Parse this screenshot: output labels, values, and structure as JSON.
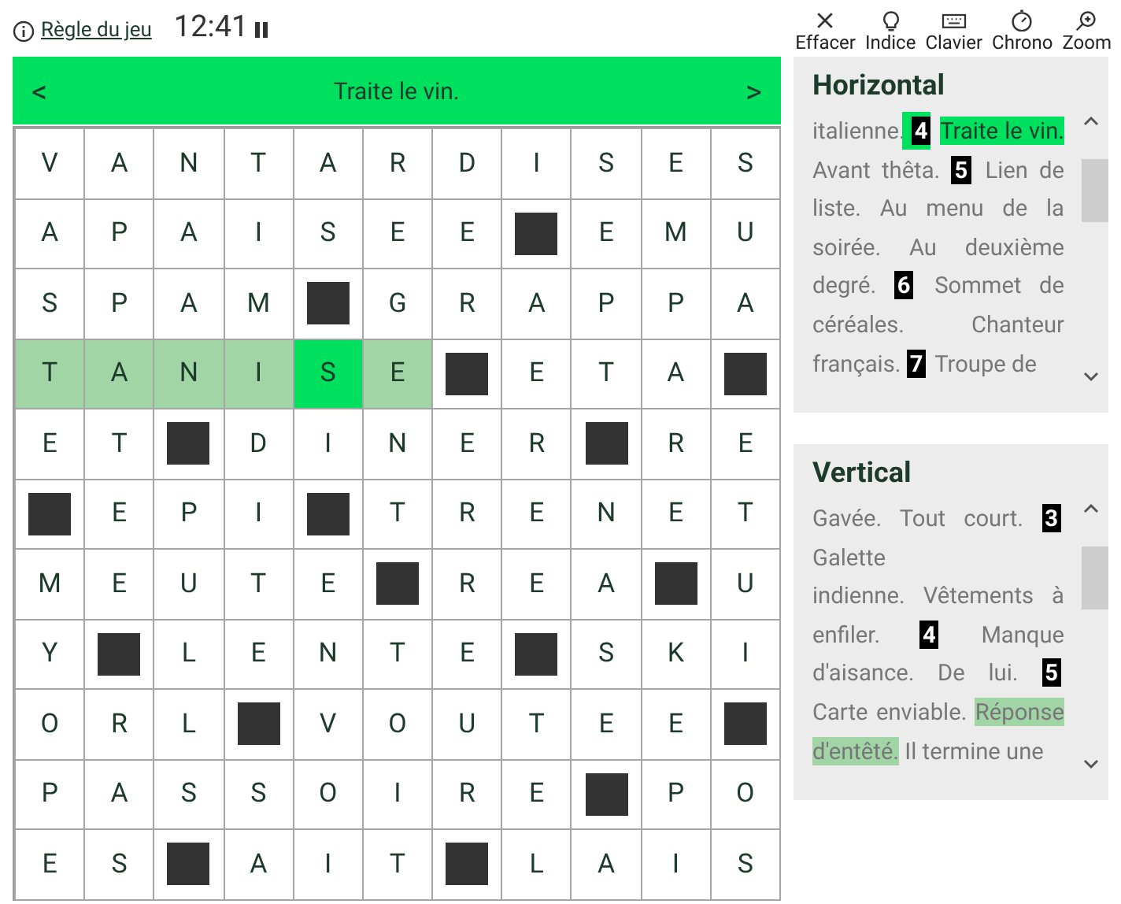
{
  "header": {
    "rules_link": "Règle du jeu",
    "timer": "12:41",
    "paused": false,
    "tools": [
      {
        "kind": "clear",
        "label": "Effacer"
      },
      {
        "kind": "hint",
        "label": "Indice"
      },
      {
        "kind": "keyboard",
        "label": "Clavier"
      },
      {
        "kind": "chrono",
        "label": "Chrono"
      },
      {
        "kind": "zoom",
        "label": "Zoom"
      }
    ]
  },
  "clue_bar": {
    "prev": "<",
    "clue": "Traite le vin.",
    "next": ">"
  },
  "grid": {
    "rows": [
      {
        "cells": [
          {
            "kind": "letter",
            "letter": "V",
            "in_word": false,
            "selected": false
          },
          {
            "kind": "letter",
            "letter": "A",
            "in_word": false,
            "selected": false
          },
          {
            "kind": "letter",
            "letter": "N",
            "in_word": false,
            "selected": false
          },
          {
            "kind": "letter",
            "letter": "T",
            "in_word": false,
            "selected": false
          },
          {
            "kind": "letter",
            "letter": "A",
            "in_word": false,
            "selected": false
          },
          {
            "kind": "letter",
            "letter": "R",
            "in_word": false,
            "selected": false
          },
          {
            "kind": "letter",
            "letter": "D",
            "in_word": false,
            "selected": false
          },
          {
            "kind": "letter",
            "letter": "I",
            "in_word": false,
            "selected": false
          },
          {
            "kind": "letter",
            "letter": "S",
            "in_word": false,
            "selected": false
          },
          {
            "kind": "letter",
            "letter": "E",
            "in_word": false,
            "selected": false
          },
          {
            "kind": "letter",
            "letter": "S",
            "in_word": false,
            "selected": false
          }
        ]
      },
      {
        "cells": [
          {
            "kind": "letter",
            "letter": "A",
            "in_word": false,
            "selected": false
          },
          {
            "kind": "letter",
            "letter": "P",
            "in_word": false,
            "selected": false
          },
          {
            "kind": "letter",
            "letter": "A",
            "in_word": false,
            "selected": false
          },
          {
            "kind": "letter",
            "letter": "I",
            "in_word": false,
            "selected": false
          },
          {
            "kind": "letter",
            "letter": "S",
            "in_word": false,
            "selected": false
          },
          {
            "kind": "letter",
            "letter": "E",
            "in_word": false,
            "selected": false
          },
          {
            "kind": "letter",
            "letter": "E",
            "in_word": false,
            "selected": false
          },
          {
            "kind": "block",
            "in_word": false,
            "selected": false
          },
          {
            "kind": "letter",
            "letter": "E",
            "in_word": false,
            "selected": false
          },
          {
            "kind": "letter",
            "letter": "M",
            "in_word": false,
            "selected": false
          },
          {
            "kind": "letter",
            "letter": "U",
            "in_word": false,
            "selected": false
          }
        ]
      },
      {
        "cells": [
          {
            "kind": "letter",
            "letter": "S",
            "in_word": false,
            "selected": false
          },
          {
            "kind": "letter",
            "letter": "P",
            "in_word": false,
            "selected": false
          },
          {
            "kind": "letter",
            "letter": "A",
            "in_word": false,
            "selected": false
          },
          {
            "kind": "letter",
            "letter": "M",
            "in_word": false,
            "selected": false
          },
          {
            "kind": "block",
            "in_word": false,
            "selected": false
          },
          {
            "kind": "letter",
            "letter": "G",
            "in_word": false,
            "selected": false
          },
          {
            "kind": "letter",
            "letter": "R",
            "in_word": false,
            "selected": false
          },
          {
            "kind": "letter",
            "letter": "A",
            "in_word": false,
            "selected": false
          },
          {
            "kind": "letter",
            "letter": "P",
            "in_word": false,
            "selected": false
          },
          {
            "kind": "letter",
            "letter": "P",
            "in_word": false,
            "selected": false
          },
          {
            "kind": "letter",
            "letter": "A",
            "in_word": false,
            "selected": false
          }
        ]
      },
      {
        "cells": [
          {
            "kind": "letter",
            "letter": "T",
            "in_word": true,
            "selected": false
          },
          {
            "kind": "letter",
            "letter": "A",
            "in_word": true,
            "selected": false
          },
          {
            "kind": "letter",
            "letter": "N",
            "in_word": true,
            "selected": false
          },
          {
            "kind": "letter",
            "letter": "I",
            "in_word": true,
            "selected": false
          },
          {
            "kind": "letter",
            "letter": "S",
            "in_word": true,
            "selected": true
          },
          {
            "kind": "letter",
            "letter": "E",
            "in_word": true,
            "selected": false
          },
          {
            "kind": "block",
            "in_word": false,
            "selected": false
          },
          {
            "kind": "letter",
            "letter": "E",
            "in_word": false,
            "selected": false
          },
          {
            "kind": "letter",
            "letter": "T",
            "in_word": false,
            "selected": false
          },
          {
            "kind": "letter",
            "letter": "A",
            "in_word": false,
            "selected": false
          },
          {
            "kind": "block",
            "in_word": false,
            "selected": false
          }
        ]
      },
      {
        "cells": [
          {
            "kind": "letter",
            "letter": "E",
            "in_word": false,
            "selected": false
          },
          {
            "kind": "letter",
            "letter": "T",
            "in_word": false,
            "selected": false
          },
          {
            "kind": "block",
            "in_word": false,
            "selected": false
          },
          {
            "kind": "letter",
            "letter": "D",
            "in_word": false,
            "selected": false
          },
          {
            "kind": "letter",
            "letter": "I",
            "in_word": false,
            "selected": false
          },
          {
            "kind": "letter",
            "letter": "N",
            "in_word": false,
            "selected": false
          },
          {
            "kind": "letter",
            "letter": "E",
            "in_word": false,
            "selected": false
          },
          {
            "kind": "letter",
            "letter": "R",
            "in_word": false,
            "selected": false
          },
          {
            "kind": "block",
            "in_word": false,
            "selected": false
          },
          {
            "kind": "letter",
            "letter": "R",
            "in_word": false,
            "selected": false
          },
          {
            "kind": "letter",
            "letter": "E",
            "in_word": false,
            "selected": false
          }
        ]
      },
      {
        "cells": [
          {
            "kind": "block",
            "in_word": false,
            "selected": false
          },
          {
            "kind": "letter",
            "letter": "E",
            "in_word": false,
            "selected": false
          },
          {
            "kind": "letter",
            "letter": "P",
            "in_word": false,
            "selected": false
          },
          {
            "kind": "letter",
            "letter": "I",
            "in_word": false,
            "selected": false
          },
          {
            "kind": "block",
            "in_word": false,
            "selected": false
          },
          {
            "kind": "letter",
            "letter": "T",
            "in_word": false,
            "selected": false
          },
          {
            "kind": "letter",
            "letter": "R",
            "in_word": false,
            "selected": false
          },
          {
            "kind": "letter",
            "letter": "E",
            "in_word": false,
            "selected": false
          },
          {
            "kind": "letter",
            "letter": "N",
            "in_word": false,
            "selected": false
          },
          {
            "kind": "letter",
            "letter": "E",
            "in_word": false,
            "selected": false
          },
          {
            "kind": "letter",
            "letter": "T",
            "in_word": false,
            "selected": false
          }
        ]
      },
      {
        "cells": [
          {
            "kind": "letter",
            "letter": "M",
            "in_word": false,
            "selected": false
          },
          {
            "kind": "letter",
            "letter": "E",
            "in_word": false,
            "selected": false
          },
          {
            "kind": "letter",
            "letter": "U",
            "in_word": false,
            "selected": false
          },
          {
            "kind": "letter",
            "letter": "T",
            "in_word": false,
            "selected": false
          },
          {
            "kind": "letter",
            "letter": "E",
            "in_word": false,
            "selected": false
          },
          {
            "kind": "block",
            "in_word": false,
            "selected": false
          },
          {
            "kind": "letter",
            "letter": "R",
            "in_word": false,
            "selected": false
          },
          {
            "kind": "letter",
            "letter": "E",
            "in_word": false,
            "selected": false
          },
          {
            "kind": "letter",
            "letter": "A",
            "in_word": false,
            "selected": false
          },
          {
            "kind": "block",
            "in_word": false,
            "selected": false
          },
          {
            "kind": "letter",
            "letter": "U",
            "in_word": false,
            "selected": false
          }
        ]
      },
      {
        "cells": [
          {
            "kind": "letter",
            "letter": "Y",
            "in_word": false,
            "selected": false
          },
          {
            "kind": "block",
            "in_word": false,
            "selected": false
          },
          {
            "kind": "letter",
            "letter": "L",
            "in_word": false,
            "selected": false
          },
          {
            "kind": "letter",
            "letter": "E",
            "in_word": false,
            "selected": false
          },
          {
            "kind": "letter",
            "letter": "N",
            "in_word": false,
            "selected": false
          },
          {
            "kind": "letter",
            "letter": "T",
            "in_word": false,
            "selected": false
          },
          {
            "kind": "letter",
            "letter": "E",
            "in_word": false,
            "selected": false
          },
          {
            "kind": "block",
            "in_word": false,
            "selected": false
          },
          {
            "kind": "letter",
            "letter": "S",
            "in_word": false,
            "selected": false
          },
          {
            "kind": "letter",
            "letter": "K",
            "in_word": false,
            "selected": false
          },
          {
            "kind": "letter",
            "letter": "I",
            "in_word": false,
            "selected": false
          }
        ]
      },
      {
        "cells": [
          {
            "kind": "letter",
            "letter": "O",
            "in_word": false,
            "selected": false
          },
          {
            "kind": "letter",
            "letter": "R",
            "in_word": false,
            "selected": false
          },
          {
            "kind": "letter",
            "letter": "L",
            "in_word": false,
            "selected": false
          },
          {
            "kind": "block",
            "in_word": false,
            "selected": false
          },
          {
            "kind": "letter",
            "letter": "V",
            "in_word": false,
            "selected": false
          },
          {
            "kind": "letter",
            "letter": "O",
            "in_word": false,
            "selected": false
          },
          {
            "kind": "letter",
            "letter": "U",
            "in_word": false,
            "selected": false
          },
          {
            "kind": "letter",
            "letter": "T",
            "in_word": false,
            "selected": false
          },
          {
            "kind": "letter",
            "letter": "E",
            "in_word": false,
            "selected": false
          },
          {
            "kind": "letter",
            "letter": "E",
            "in_word": false,
            "selected": false
          },
          {
            "kind": "block",
            "in_word": false,
            "selected": false
          }
        ]
      },
      {
        "cells": [
          {
            "kind": "letter",
            "letter": "P",
            "in_word": false,
            "selected": false
          },
          {
            "kind": "letter",
            "letter": "A",
            "in_word": false,
            "selected": false
          },
          {
            "kind": "letter",
            "letter": "S",
            "in_word": false,
            "selected": false
          },
          {
            "kind": "letter",
            "letter": "S",
            "in_word": false,
            "selected": false
          },
          {
            "kind": "letter",
            "letter": "O",
            "in_word": false,
            "selected": false
          },
          {
            "kind": "letter",
            "letter": "I",
            "in_word": false,
            "selected": false
          },
          {
            "kind": "letter",
            "letter": "R",
            "in_word": false,
            "selected": false
          },
          {
            "kind": "letter",
            "letter": "E",
            "in_word": false,
            "selected": false
          },
          {
            "kind": "block",
            "in_word": false,
            "selected": false
          },
          {
            "kind": "letter",
            "letter": "P",
            "in_word": false,
            "selected": false
          },
          {
            "kind": "letter",
            "letter": "O",
            "in_word": false,
            "selected": false
          }
        ]
      },
      {
        "cells": [
          {
            "kind": "letter",
            "letter": "E",
            "in_word": false,
            "selected": false
          },
          {
            "kind": "letter",
            "letter": "S",
            "in_word": false,
            "selected": false
          },
          {
            "kind": "block",
            "in_word": false,
            "selected": false
          },
          {
            "kind": "letter",
            "letter": "A",
            "in_word": false,
            "selected": false
          },
          {
            "kind": "letter",
            "letter": "I",
            "in_word": false,
            "selected": false
          },
          {
            "kind": "letter",
            "letter": "T",
            "in_word": false,
            "selected": false
          },
          {
            "kind": "block",
            "in_word": false,
            "selected": false
          },
          {
            "kind": "letter",
            "letter": "L",
            "in_word": false,
            "selected": false
          },
          {
            "kind": "letter",
            "letter": "A",
            "in_word": false,
            "selected": false
          },
          {
            "kind": "letter",
            "letter": "I",
            "in_word": false,
            "selected": false
          },
          {
            "kind": "letter",
            "letter": "S",
            "in_word": false,
            "selected": false
          }
        ]
      }
    ]
  },
  "panels": [
    {
      "title": "Horizontal",
      "segments": [
        {
          "kind": "text",
          "text": "italienne.",
          "active": false,
          "crossing": false
        },
        {
          "kind": "number",
          "text": "4",
          "active": true,
          "crossing": false
        },
        {
          "kind": "text",
          "text": "Traite le vin.",
          "active": true,
          "crossing": false
        },
        {
          "kind": "text",
          "text": "Avant thêta.",
          "active": false,
          "crossing": false
        },
        {
          "kind": "number",
          "text": "5",
          "active": false,
          "crossing": false
        },
        {
          "kind": "text",
          "text": "Lien de liste. Au menu de la soirée. Au deuxième degré.",
          "active": false,
          "crossing": false
        },
        {
          "kind": "number",
          "text": "6",
          "active": false,
          "crossing": false
        },
        {
          "kind": "text",
          "text": "Sommet de céréales. Chanteur français.",
          "active": false,
          "crossing": false
        },
        {
          "kind": "number",
          "text": "7",
          "active": false,
          "crossing": false
        },
        {
          "kind": "text",
          "text": "Troupe de",
          "active": false,
          "crossing": false
        }
      ]
    },
    {
      "title": "Vertical",
      "segments": [
        {
          "kind": "text",
          "text": "Gavée. Tout court.",
          "active": false,
          "crossing": false
        },
        {
          "kind": "number",
          "text": "3",
          "active": false,
          "crossing": false
        },
        {
          "kind": "text",
          "text": "Galette",
          "active": false,
          "crossing": false
        },
        {
          "kind": "break"
        },
        {
          "kind": "text",
          "text": "indienne. Vêtements à enfiler.",
          "active": false,
          "crossing": false
        },
        {
          "kind": "number",
          "text": "4",
          "active": false,
          "crossing": false
        },
        {
          "kind": "text",
          "text": "Manque d'aisance. De lui.",
          "active": false,
          "crossing": false
        },
        {
          "kind": "number",
          "text": "5",
          "active": false,
          "crossing": false
        },
        {
          "kind": "text",
          "text": "Carte enviable.",
          "active": false,
          "crossing": false
        },
        {
          "kind": "text",
          "text": "Réponse d'entêté.",
          "active": false,
          "crossing": true
        },
        {
          "kind": "text",
          "text": "Il termine une",
          "active": false,
          "crossing": false
        }
      ]
    }
  ]
}
